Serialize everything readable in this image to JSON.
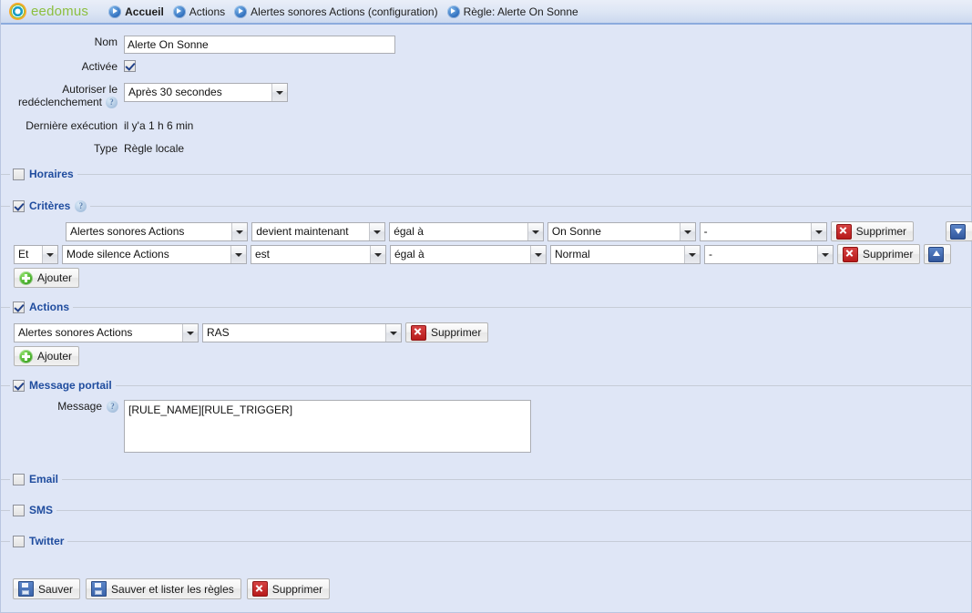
{
  "brand": {
    "name": "eedomus",
    "logo_icon": "eedomus-ring-logo"
  },
  "breadcrumb": [
    {
      "label": "Accueil",
      "icon": "blue-arrow-circle-icon",
      "current": true
    },
    {
      "label": "Actions",
      "icon": "blue-arrow-circle-icon",
      "current": false
    },
    {
      "label": "Alertes sonores Actions (configuration)",
      "icon": "blue-arrow-circle-icon",
      "current": false
    },
    {
      "label": "Règle: Alerte On Sonne",
      "icon": "blue-arrow-circle-icon",
      "current": false
    }
  ],
  "form": {
    "nom": {
      "label": "Nom",
      "value": "Alerte On Sonne"
    },
    "activee": {
      "label": "Activée",
      "checked": true
    },
    "redeclenchement": {
      "label_line1": "Autoriser le",
      "label_line2": "redéclenchement",
      "help_icon": "help-icon",
      "value": "Après 30 secondes"
    },
    "derniere_execution": {
      "label": "Dernière exécution",
      "value": "il y'a 1 h 6 min"
    },
    "type": {
      "label": "Type",
      "value": "Règle locale"
    }
  },
  "sections": {
    "horaires": {
      "legend": "Horaires",
      "checked": false
    },
    "criteres": {
      "legend": "Critères",
      "checked": true,
      "help_icon": "help-icon",
      "rows": [
        {
          "logic": null,
          "source": "Alertes sonores Actions",
          "event": "devient maintenant",
          "comparator": "égal à",
          "value": "On Sonne",
          "extra": "-",
          "delete_label": "Supprimer",
          "move_icon": "arrow-down-icon"
        },
        {
          "logic": "Et",
          "source": "Mode silence Actions",
          "event": "est",
          "comparator": "égal à",
          "value": "Normal",
          "extra": "-",
          "delete_label": "Supprimer",
          "move_icon": "arrow-up-icon"
        }
      ],
      "add_label": "Ajouter"
    },
    "actions": {
      "legend": "Actions",
      "checked": true,
      "rows": [
        {
          "target": "Alertes sonores Actions",
          "command": "RAS",
          "delete_label": "Supprimer"
        }
      ],
      "add_label": "Ajouter"
    },
    "message_portail": {
      "legend": "Message portail",
      "checked": true,
      "message_label": "Message",
      "help_icon": "help-icon",
      "message_value": "[RULE_NAME][RULE_TRIGGER]"
    },
    "email": {
      "legend": "Email",
      "checked": false
    },
    "sms": {
      "legend": "SMS",
      "checked": false
    },
    "twitter": {
      "legend": "Twitter",
      "checked": false
    }
  },
  "footer": {
    "save": {
      "label": "Sauver",
      "icon": "save-icon"
    },
    "save_and_list": {
      "label": "Sauver et lister les règles",
      "icon": "save-icon"
    },
    "delete": {
      "label": "Supprimer",
      "icon": "delete-icon"
    }
  },
  "colors": {
    "page_bg": "#dfe6f6",
    "legend_blue": "#1f4c9e",
    "brand_green": "#8cbf3f",
    "accent_blue": "#2f6fbe",
    "danger_red": "#b71a1a"
  }
}
